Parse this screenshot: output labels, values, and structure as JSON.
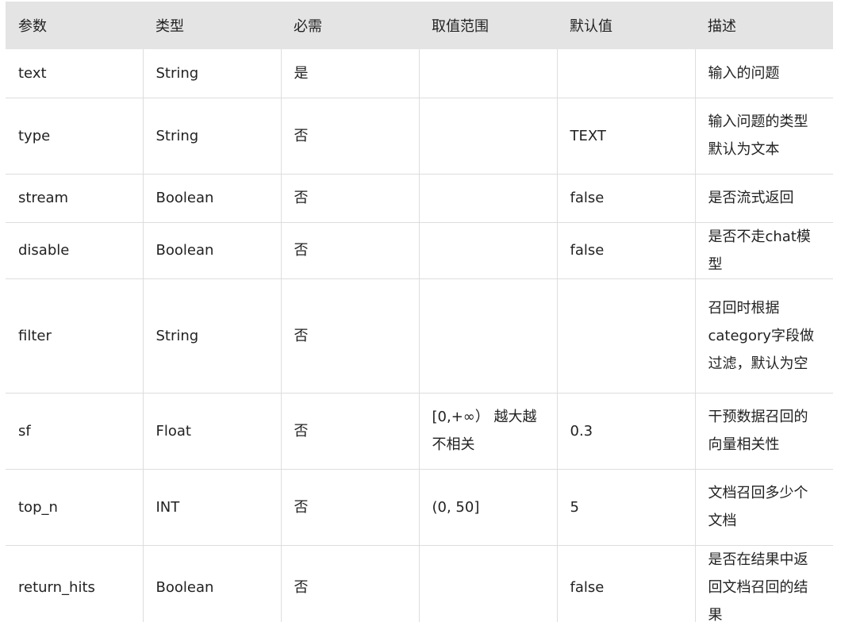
{
  "table": {
    "headers": [
      "参数",
      "类型",
      "必需",
      "取值范围",
      "默认值",
      "描述"
    ],
    "rows": [
      [
        "text",
        "String",
        "是",
        "",
        "",
        "输入的问题"
      ],
      [
        "type",
        "String",
        "否",
        "",
        "TEXT",
        "输入问题的类型默认为文本"
      ],
      [
        "stream",
        "Boolean",
        "否",
        "",
        "false",
        "是否流式返回"
      ],
      [
        "disable",
        "Boolean",
        "否",
        "",
        "false",
        "是否不走chat模型"
      ],
      [
        "filter",
        "String",
        "否",
        "",
        "",
        "召回时根据category字段做过滤，默认为空"
      ],
      [
        "sf",
        "Float",
        "否",
        "[0,+∞）  越大越不相关",
        "0.3",
        "干预数据召回的向量相关性"
      ],
      [
        "top_n",
        "INT",
        "否",
        "(0, 50]",
        "5",
        "文档召回多少个文档"
      ],
      [
        "return_hits",
        "Boolean",
        "否",
        "",
        "false",
        "是否在结果中返回文档召回的结果"
      ]
    ]
  }
}
